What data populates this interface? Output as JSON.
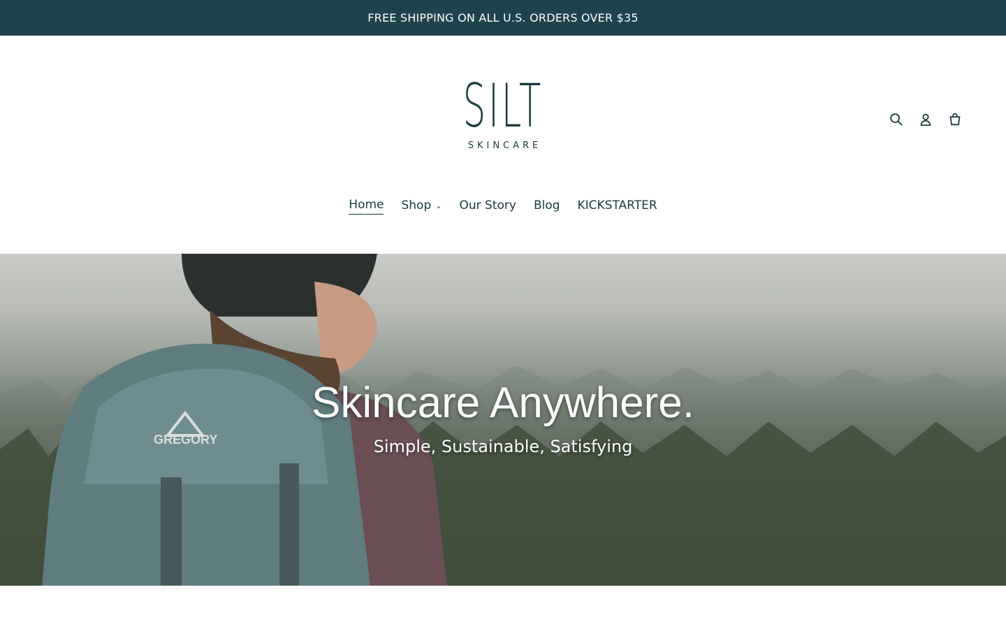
{
  "announcement": {
    "text": "FREE SHIPPING ON ALL U.S. ORDERS OVER $35"
  },
  "header": {
    "logo": {
      "mark": "SILT",
      "subtitle": "SKINCARE"
    },
    "icons": [
      "search-icon",
      "account-icon",
      "cart-icon"
    ]
  },
  "nav": {
    "items": [
      {
        "label": "Home",
        "active": true
      },
      {
        "label": "Shop",
        "has_dropdown": true
      },
      {
        "label": "Our Story"
      },
      {
        "label": "Blog"
      },
      {
        "label": "KICKSTARTER"
      }
    ]
  },
  "hero": {
    "title": "Skincare Anywhere.",
    "subtitle": "Simple, Sustainable, Satisfying",
    "backpack_brand": "GREGORY"
  },
  "colors": {
    "announcement_bg": "#1f424d",
    "text_primary": "#1b3a3f",
    "white": "#ffffff"
  }
}
